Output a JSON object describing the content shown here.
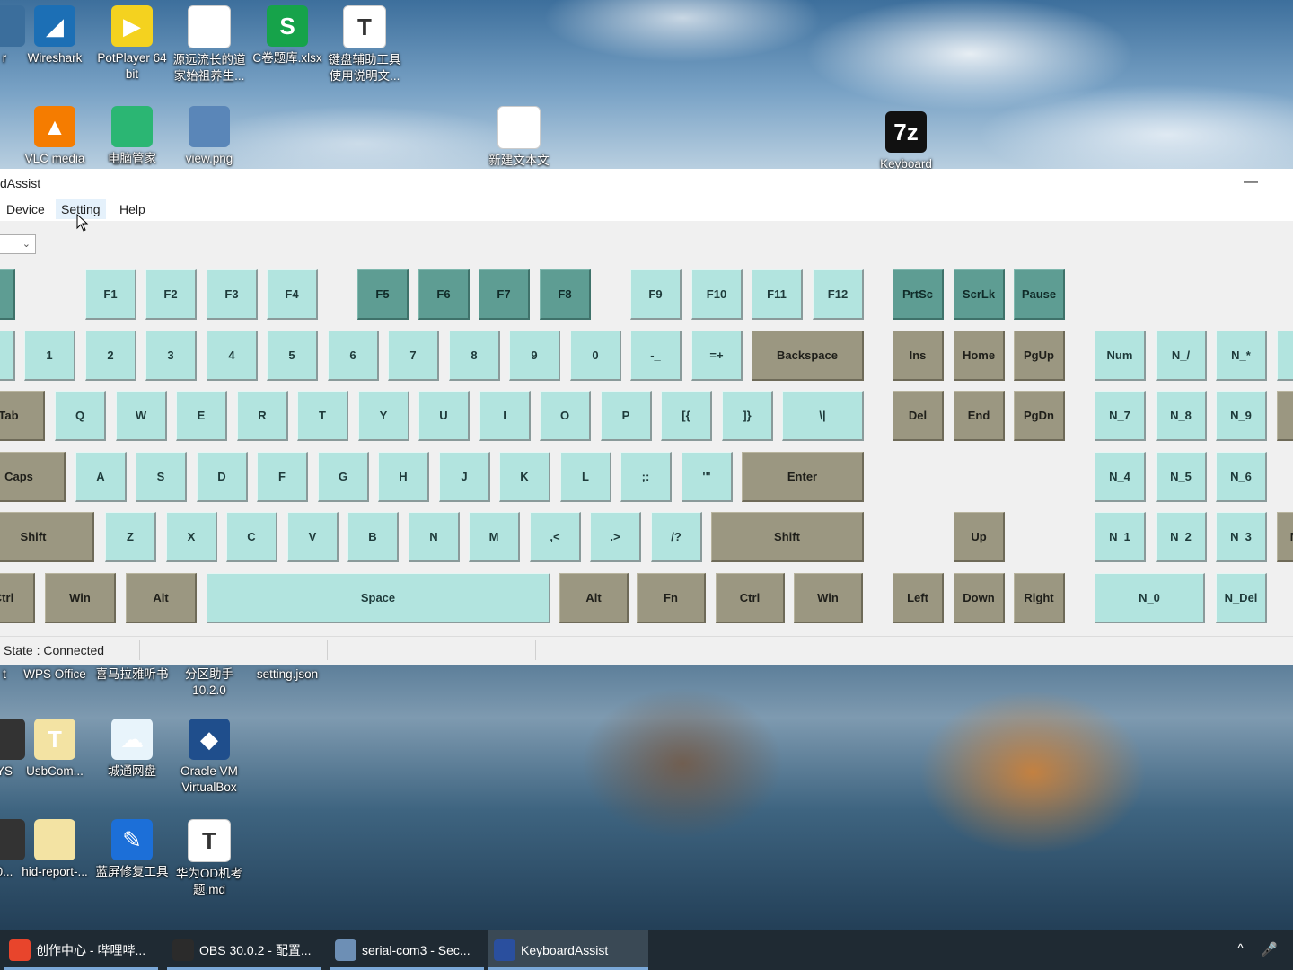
{
  "desktop": {
    "top_icons": [
      {
        "label": "r",
        "glyph": "",
        "color": "#3b6e9c"
      },
      {
        "label": "Wireshark",
        "glyph": "◢",
        "color": "#1c6fb5"
      },
      {
        "label": "PotPlayer 64\nbit",
        "glyph": "▶",
        "color": "#f4d21f"
      },
      {
        "label": "源远流长的道\n家始祖养生...",
        "glyph": "",
        "color": "#ffffff"
      },
      {
        "label": "C卷题库.xlsx",
        "glyph": "S",
        "color": "#16a34a"
      },
      {
        "label": "键盘辅助工具\n使用说明文...",
        "glyph": "T",
        "color": "#ffffff"
      },
      {
        "label": "VLC media",
        "glyph": "▲",
        "color": "#f57c00"
      },
      {
        "label": "电脑管家",
        "glyph": "",
        "color": "#2bb673"
      },
      {
        "label": "view.png",
        "glyph": "",
        "color": "#5a86b8"
      },
      {
        "label": "新建文本文",
        "glyph": "",
        "color": "#ffffff"
      },
      {
        "label": "Keyboard",
        "glyph": "7z",
        "color": "#111111"
      }
    ],
    "bottom_icons": [
      {
        "label": "t",
        "glyph": "",
        "color": "#333"
      },
      {
        "label": "WPS Office",
        "glyph": "",
        "color": "#333"
      },
      {
        "label": "喜马拉雅听书",
        "glyph": "",
        "color": "#333"
      },
      {
        "label": "分区助手\n10.2.0",
        "glyph": "",
        "color": "#333"
      },
      {
        "label": "setting.json",
        "glyph": "",
        "color": "#333"
      },
      {
        "label": "YS",
        "glyph": "",
        "color": "#333"
      },
      {
        "label": "UsbCom...",
        "glyph": "T",
        "color": "#f3e3a3"
      },
      {
        "label": "城通网盘",
        "glyph": "☁",
        "color": "#e8f4fb"
      },
      {
        "label": "Oracle VM\nVirtualBox",
        "glyph": "◆",
        "color": "#1f4e8c"
      },
      {
        "label": "0...",
        "glyph": "",
        "color": "#333"
      },
      {
        "label": "hid-report-...",
        "glyph": "",
        "color": "#f3e3a3"
      },
      {
        "label": "蓝屏修复工具",
        "glyph": "✎",
        "color": "#1c6fd8"
      },
      {
        "label": "华为OD机考\n题.md",
        "glyph": "T",
        "color": "#ffffff"
      }
    ]
  },
  "window": {
    "title": "dAssist",
    "minimize": "—",
    "menu": [
      "Device",
      "Setting",
      "Help"
    ],
    "combo_chevron": "⌄",
    "status": "State : Connected"
  },
  "keyboard": {
    "colors": {
      "light": "#b2e4df",
      "dark": "#9b9781",
      "teal": "#5e9d93"
    },
    "keys": [
      {
        "label": "",
        "style": "teal"
      },
      {
        "label": "F1",
        "style": "light"
      },
      {
        "label": "F2",
        "style": "light"
      },
      {
        "label": "F3",
        "style": "light"
      },
      {
        "label": "F4",
        "style": "light"
      },
      {
        "label": "F5",
        "style": "teal"
      },
      {
        "label": "F6",
        "style": "teal"
      },
      {
        "label": "F7",
        "style": "teal"
      },
      {
        "label": "F8",
        "style": "teal"
      },
      {
        "label": "F9",
        "style": "light"
      },
      {
        "label": "F10",
        "style": "light"
      },
      {
        "label": "F11",
        "style": "light"
      },
      {
        "label": "F12",
        "style": "light"
      },
      {
        "label": "PrtSc",
        "style": "teal"
      },
      {
        "label": "ScrLk",
        "style": "teal"
      },
      {
        "label": "Pause",
        "style": "teal"
      },
      {
        "label": "",
        "style": "light"
      },
      {
        "label": "1",
        "style": "light"
      },
      {
        "label": "2",
        "style": "light"
      },
      {
        "label": "3",
        "style": "light"
      },
      {
        "label": "4",
        "style": "light"
      },
      {
        "label": "5",
        "style": "light"
      },
      {
        "label": "6",
        "style": "light"
      },
      {
        "label": "7",
        "style": "light"
      },
      {
        "label": "8",
        "style": "light"
      },
      {
        "label": "9",
        "style": "light"
      },
      {
        "label": "0",
        "style": "light"
      },
      {
        "label": "-_",
        "style": "light"
      },
      {
        "label": "=+",
        "style": "light"
      },
      {
        "label": "Backspace",
        "style": "dark"
      },
      {
        "label": "Ins",
        "style": "dark"
      },
      {
        "label": "Home",
        "style": "dark"
      },
      {
        "label": "PgUp",
        "style": "dark"
      },
      {
        "label": "Num",
        "style": "light"
      },
      {
        "label": "N_/",
        "style": "light"
      },
      {
        "label": "N_*",
        "style": "light"
      },
      {
        "label": "",
        "style": "light"
      },
      {
        "label": "Tab",
        "style": "dark"
      },
      {
        "label": "Q",
        "style": "light"
      },
      {
        "label": "W",
        "style": "light"
      },
      {
        "label": "E",
        "style": "light"
      },
      {
        "label": "R",
        "style": "light"
      },
      {
        "label": "T",
        "style": "light"
      },
      {
        "label": "Y",
        "style": "light"
      },
      {
        "label": "U",
        "style": "light"
      },
      {
        "label": "I",
        "style": "light"
      },
      {
        "label": "O",
        "style": "light"
      },
      {
        "label": "P",
        "style": "light"
      },
      {
        "label": "[{",
        "style": "light"
      },
      {
        "label": "]}",
        "style": "light"
      },
      {
        "label": "\\|",
        "style": "light"
      },
      {
        "label": "Del",
        "style": "dark"
      },
      {
        "label": "End",
        "style": "dark"
      },
      {
        "label": "PgDn",
        "style": "dark"
      },
      {
        "label": "N_7",
        "style": "light"
      },
      {
        "label": "N_8",
        "style": "light"
      },
      {
        "label": "N_9",
        "style": "light"
      },
      {
        "label": "",
        "style": "dark"
      },
      {
        "label": "Caps",
        "style": "dark"
      },
      {
        "label": "A",
        "style": "light"
      },
      {
        "label": "S",
        "style": "light"
      },
      {
        "label": "D",
        "style": "light"
      },
      {
        "label": "F",
        "style": "light"
      },
      {
        "label": "G",
        "style": "light"
      },
      {
        "label": "H",
        "style": "light"
      },
      {
        "label": "J",
        "style": "light"
      },
      {
        "label": "K",
        "style": "light"
      },
      {
        "label": "L",
        "style": "light"
      },
      {
        "label": ";:",
        "style": "light"
      },
      {
        "label": "'\"",
        "style": "light"
      },
      {
        "label": "Enter",
        "style": "dark"
      },
      {
        "label": "N_4",
        "style": "light"
      },
      {
        "label": "N_5",
        "style": "light"
      },
      {
        "label": "N_6",
        "style": "light"
      },
      {
        "label": "Shift",
        "style": "dark"
      },
      {
        "label": "Z",
        "style": "light"
      },
      {
        "label": "X",
        "style": "light"
      },
      {
        "label": "C",
        "style": "light"
      },
      {
        "label": "V",
        "style": "light"
      },
      {
        "label": "B",
        "style": "light"
      },
      {
        "label": "N",
        "style": "light"
      },
      {
        "label": "M",
        "style": "light"
      },
      {
        "label": ",<",
        "style": "light"
      },
      {
        "label": ".>",
        "style": "light"
      },
      {
        "label": "/?",
        "style": "light"
      },
      {
        "label": "Shift",
        "style": "dark"
      },
      {
        "label": "Up",
        "style": "dark"
      },
      {
        "label": "N_1",
        "style": "light"
      },
      {
        "label": "N_2",
        "style": "light"
      },
      {
        "label": "N_3",
        "style": "light"
      },
      {
        "label": "N",
        "style": "dark"
      },
      {
        "label": "Ctrl",
        "style": "dark"
      },
      {
        "label": "Win",
        "style": "dark"
      },
      {
        "label": "Alt",
        "style": "dark"
      },
      {
        "label": "Space",
        "style": "light"
      },
      {
        "label": "Alt",
        "style": "dark"
      },
      {
        "label": "Fn",
        "style": "dark"
      },
      {
        "label": "Ctrl",
        "style": "dark"
      },
      {
        "label": "Win",
        "style": "dark"
      },
      {
        "label": "Left",
        "style": "dark"
      },
      {
        "label": "Down",
        "style": "dark"
      },
      {
        "label": "Right",
        "style": "dark"
      },
      {
        "label": "N_0",
        "style": "light"
      },
      {
        "label": "N_Del",
        "style": "light"
      }
    ]
  },
  "taskbar": {
    "items": [
      {
        "label": "创作中心 - 哔哩哔...",
        "icon_color": "#e8452c",
        "active": false
      },
      {
        "label": "OBS 30.0.2 - 配置...",
        "icon_color": "#2b2b2b",
        "active": false
      },
      {
        "label": "serial-com3 - Sec...",
        "icon_color": "#6d8fb5",
        "active": false
      },
      {
        "label": "KeyboardAssist",
        "icon_color": "#2a4f9e",
        "active": true
      }
    ],
    "tray_chevron": "^",
    "tray_mic": "🎤"
  }
}
